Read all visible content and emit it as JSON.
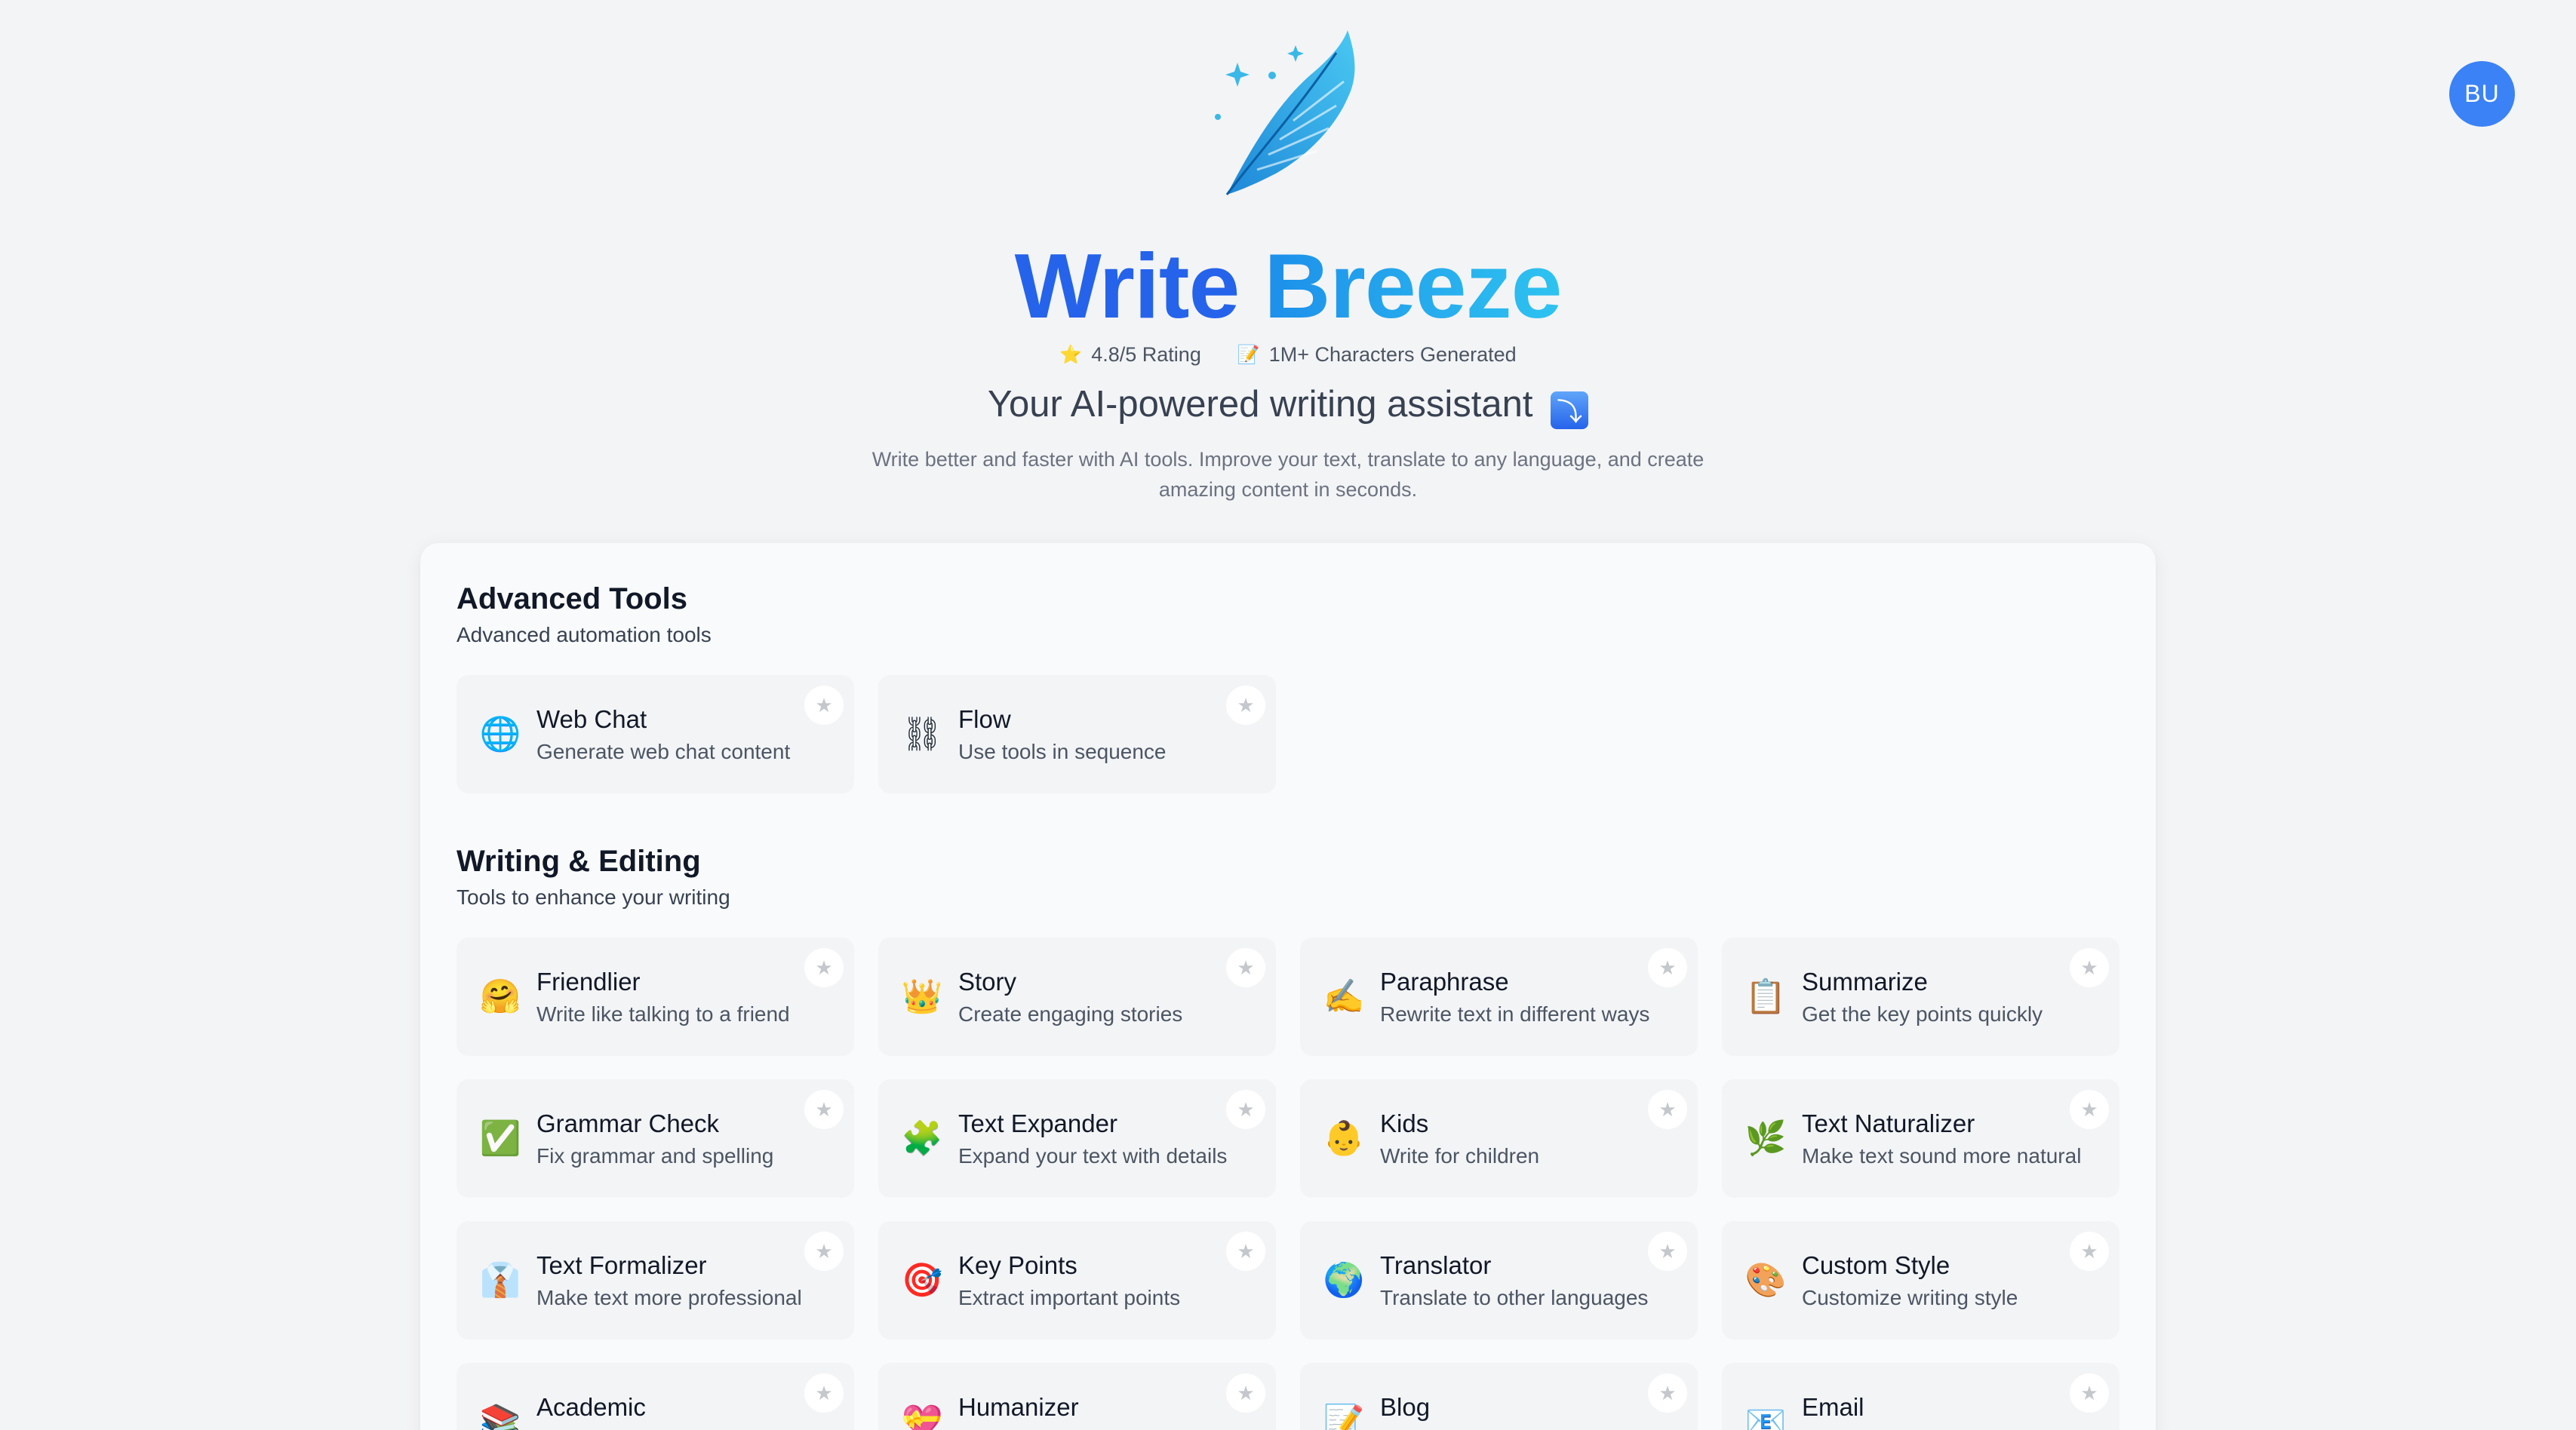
{
  "user": {
    "initials": "BU"
  },
  "brand": {
    "word1": "Write",
    "word2": "Breeze"
  },
  "stats": [
    {
      "emoji": "⭐",
      "text": "4.8/5 Rating"
    },
    {
      "emoji": "📝",
      "text": "1M+ Characters Generated"
    }
  ],
  "tagline": {
    "text": "Your AI-powered writing assistant",
    "badge": "⤵"
  },
  "description": "Write better and faster with AI tools. Improve your text, translate to any language, and create amazing content in seconds.",
  "sections": {
    "advanced": {
      "title": "Advanced Tools",
      "subtitle": "Advanced automation tools",
      "tools": [
        {
          "icon": "🌐",
          "title": "Web Chat",
          "subtitle": "Generate web chat content"
        },
        {
          "icon": "⛓",
          "title": "Flow",
          "subtitle": "Use tools in sequence"
        }
      ]
    },
    "writing": {
      "title": "Writing & Editing",
      "subtitle": "Tools to enhance your writing",
      "tools": [
        {
          "icon": "🤗",
          "title": "Friendlier",
          "subtitle": "Write like talking to a friend"
        },
        {
          "icon": "👑",
          "title": "Story",
          "subtitle": "Create engaging stories"
        },
        {
          "icon": "✍️",
          "title": "Paraphrase",
          "subtitle": "Rewrite text in different ways"
        },
        {
          "icon": "📋",
          "title": "Summarize",
          "subtitle": "Get the key points quickly"
        },
        {
          "icon": "✅",
          "title": "Grammar Check",
          "subtitle": "Fix grammar and spelling"
        },
        {
          "icon": "🧩",
          "title": "Text Expander",
          "subtitle": "Expand your text with details"
        },
        {
          "icon": "👶",
          "title": "Kids",
          "subtitle": "Write for children"
        },
        {
          "icon": "🌿",
          "title": "Text Naturalizer",
          "subtitle": "Make text sound more natural"
        },
        {
          "icon": "👔",
          "title": "Text Formalizer",
          "subtitle": "Make text more professional"
        },
        {
          "icon": "🎯",
          "title": "Key Points",
          "subtitle": "Extract important points"
        },
        {
          "icon": "🌍",
          "title": "Translator",
          "subtitle": "Translate to other languages"
        },
        {
          "icon": "🎨",
          "title": "Custom Style",
          "subtitle": "Customize writing style"
        },
        {
          "icon": "📚",
          "title": "Academic",
          "subtitle": ""
        },
        {
          "icon": "💝",
          "title": "Humanizer",
          "subtitle": ""
        },
        {
          "icon": "📝",
          "title": "Blog",
          "subtitle": ""
        },
        {
          "icon": "📧",
          "title": "Email",
          "subtitle": ""
        }
      ]
    }
  },
  "favorite_icon": "★"
}
